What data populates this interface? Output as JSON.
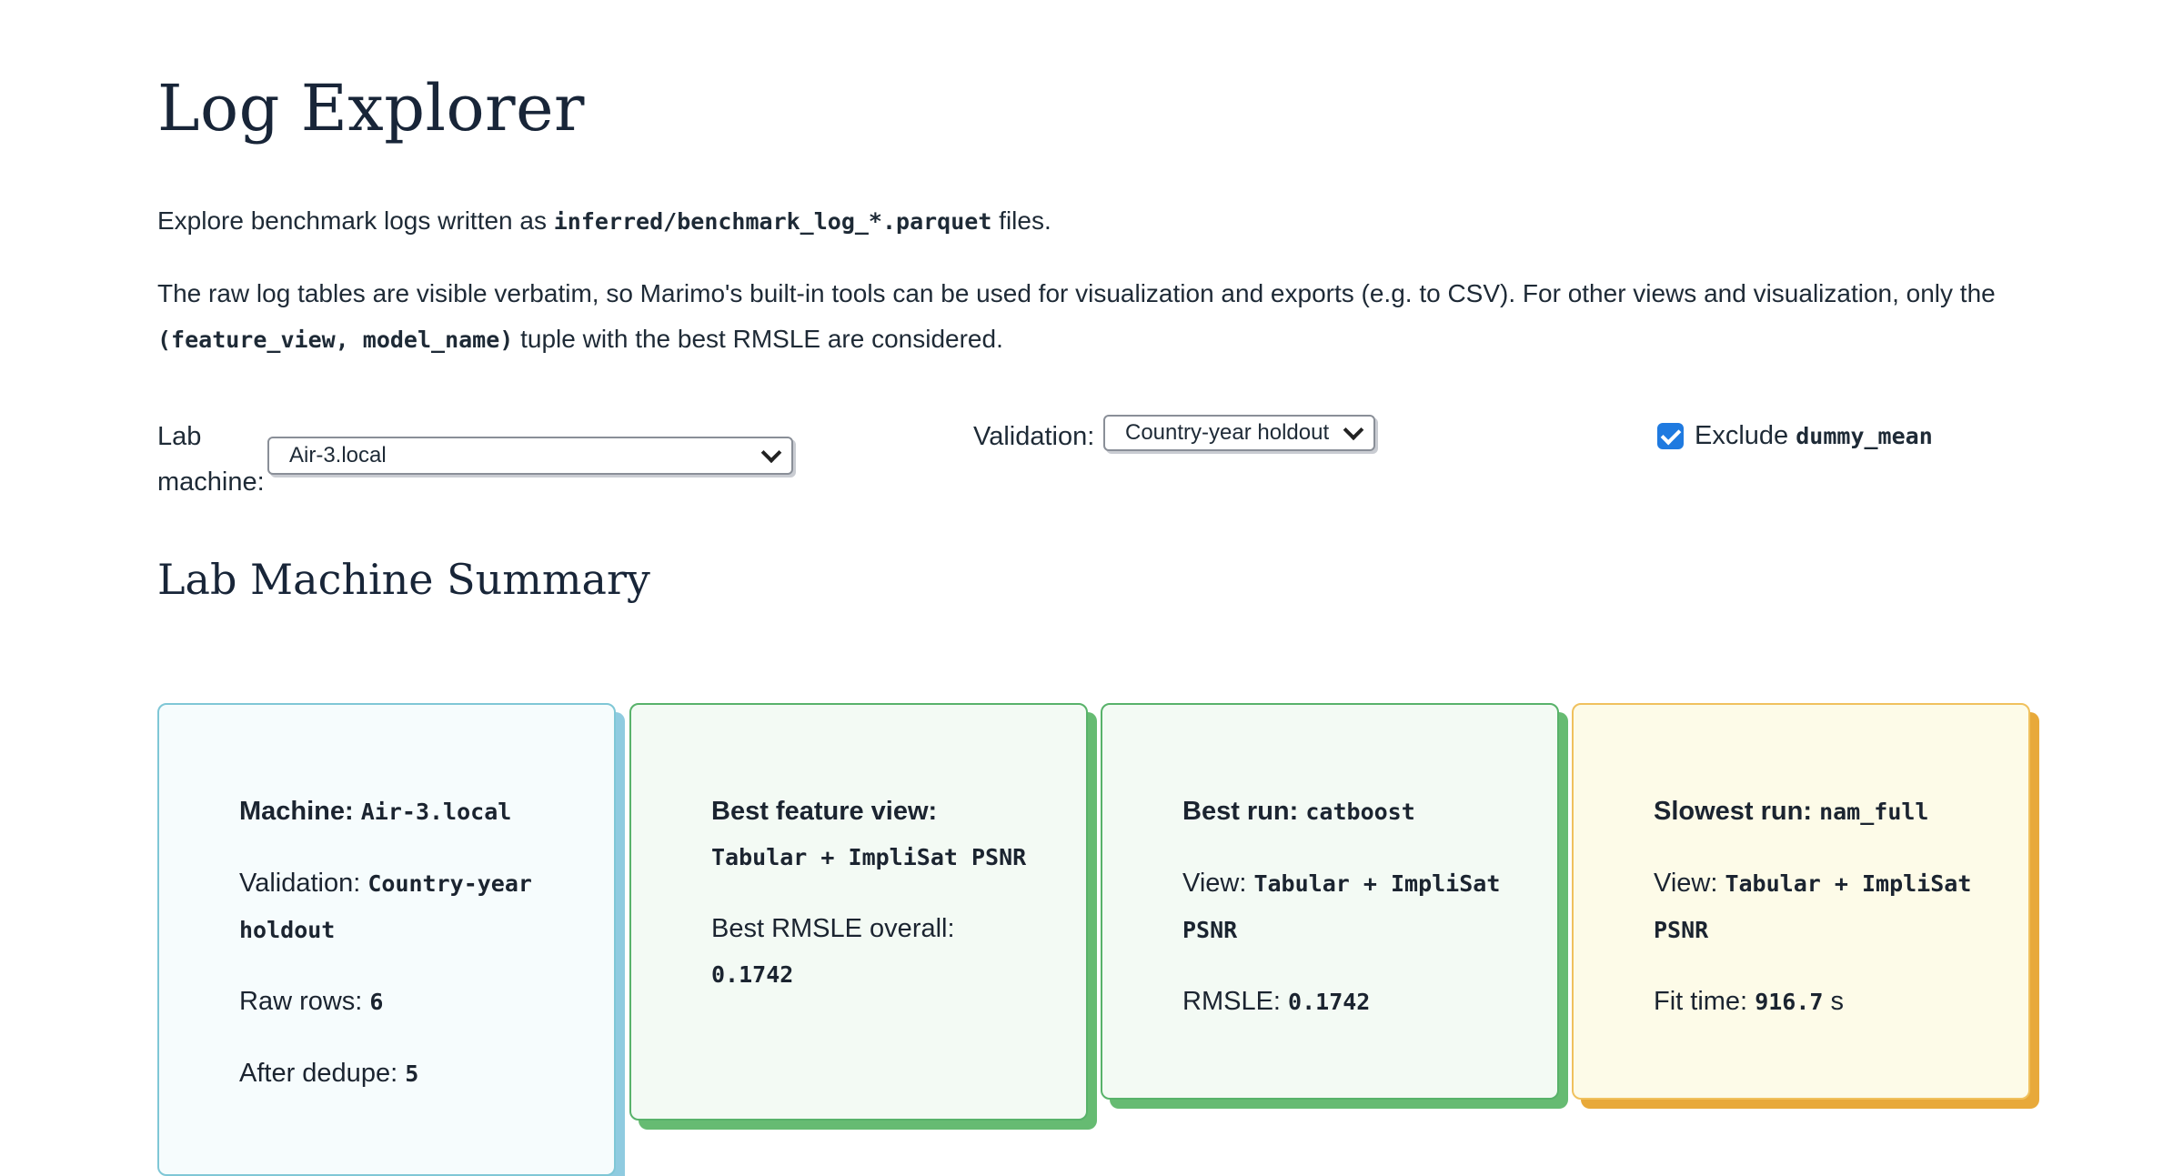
{
  "page": {
    "title": "Log Explorer",
    "intro": {
      "p1_before": "Explore benchmark logs written as ",
      "p1_code": "inferred/benchmark_log_*.parquet",
      "p1_after": " files.",
      "p2_before": "The raw log tables are visible verbatim, so Marimo's built-in tools can be used for visualization and exports (e.g. to CSV). For other views and visualization, only the ",
      "p2_code": "(feature_view, model_name)",
      "p2_after": " tuple with the best RMSLE are considered."
    }
  },
  "controls": {
    "lab_machine_label": "Lab machine:",
    "lab_machine_value": "Air-3.local",
    "validation_label": "Validation:",
    "validation_value": "Country-year holdout",
    "exclude_label": "Exclude ",
    "exclude_code": "dummy_mean",
    "exclude_checked": true
  },
  "summary": {
    "section_title": "Lab Machine Summary",
    "machine_card": {
      "machine_label": "Machine:",
      "machine_value": "Air-3.local",
      "validation_label": "Validation:",
      "validation_value": "Country-year holdout",
      "raw_rows_label": "Raw rows:",
      "raw_rows_value": "6",
      "after_dedupe_label": "After dedupe:",
      "after_dedupe_value": "5"
    },
    "feature_card": {
      "best_view_label": "Best feature view:",
      "best_view_value": "Tabular + ImpliSat PSNR",
      "best_rmsle_label": "Best RMSLE overall:",
      "best_rmsle_value": "0.1742"
    },
    "run_card": {
      "best_run_label": "Best run:",
      "best_run_value": "catboost",
      "view_label": "View:",
      "view_value": "Tabular + ImpliSat PSNR",
      "rmsle_label": "RMSLE:",
      "rmsle_value": "0.1742"
    },
    "slow_card": {
      "slowest_label": "Slowest run:",
      "slowest_value": "nam_full",
      "view_label": "View:",
      "view_value": "Tabular + ImpliSat PSNR",
      "fit_time_label": "Fit time:",
      "fit_time_value": "916.7",
      "fit_time_unit": " s"
    }
  },
  "colors": {
    "machine_card_bg": "#f6fcfd",
    "machine_card_accent": "#8fcbe0",
    "success_card_bg": "#f3faf4",
    "success_card_accent": "#66bb72",
    "warning_card_bg": "#fdfbe8",
    "warning_card_accent": "#e8a93a",
    "checkbox": "#1f7ae0"
  }
}
